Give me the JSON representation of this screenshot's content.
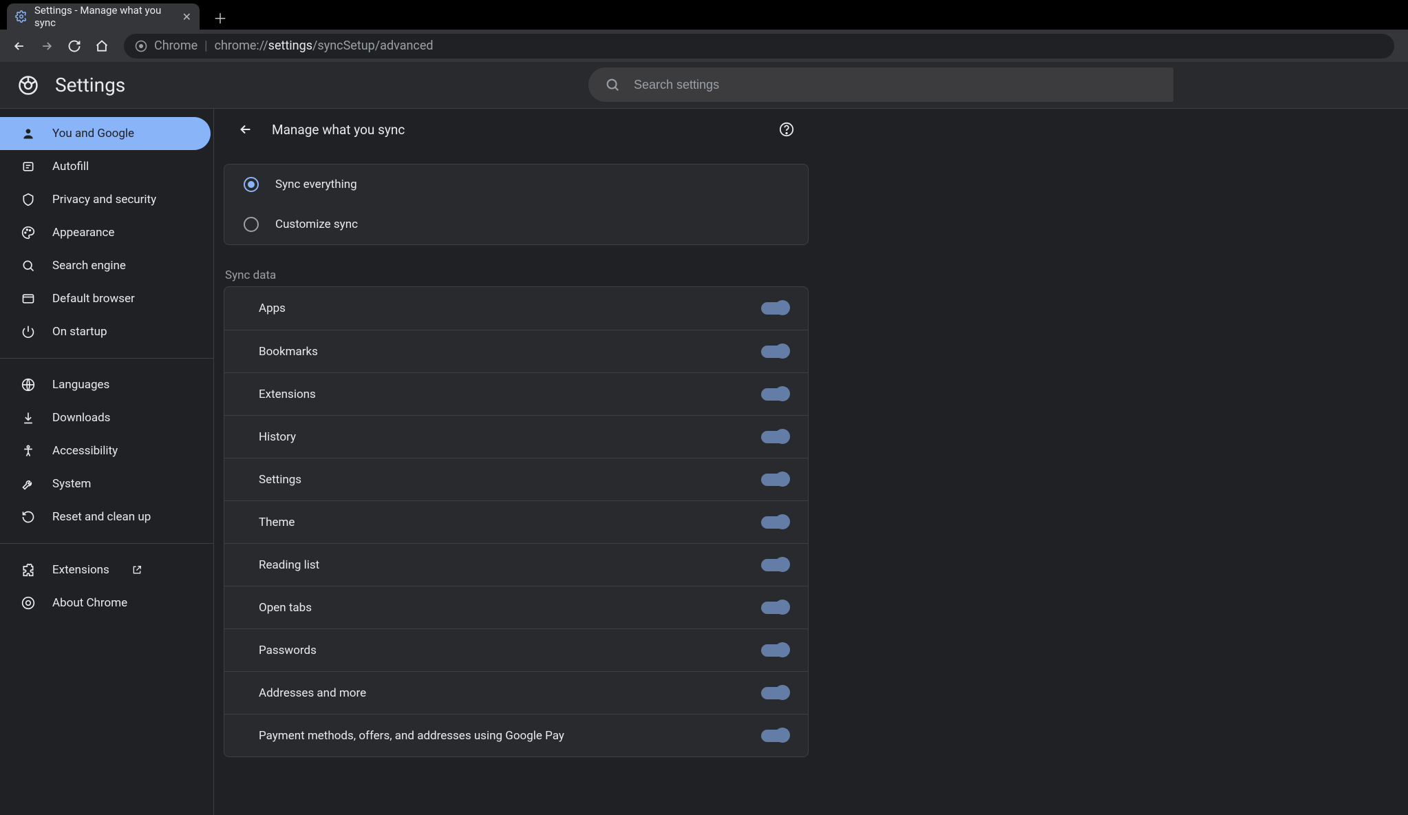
{
  "tab": {
    "title": "Settings - Manage what you sync"
  },
  "omnibox": {
    "prefix": "Chrome",
    "url_dim1": "chrome://",
    "url_bright": "settings",
    "url_dim2": "/syncSetup/advanced"
  },
  "header": {
    "app_title": "Settings",
    "search_placeholder": "Search settings"
  },
  "sidebar": {
    "group1": [
      {
        "label": "You and Google",
        "icon": "person"
      },
      {
        "label": "Autofill",
        "icon": "autofill"
      },
      {
        "label": "Privacy and security",
        "icon": "shield"
      },
      {
        "label": "Appearance",
        "icon": "palette"
      },
      {
        "label": "Search engine",
        "icon": "search"
      },
      {
        "label": "Default browser",
        "icon": "browser"
      },
      {
        "label": "On startup",
        "icon": "power"
      }
    ],
    "group2": [
      {
        "label": "Languages",
        "icon": "globe"
      },
      {
        "label": "Downloads",
        "icon": "download"
      },
      {
        "label": "Accessibility",
        "icon": "accessibility"
      },
      {
        "label": "System",
        "icon": "wrench"
      },
      {
        "label": "Reset and clean up",
        "icon": "restore"
      }
    ],
    "group3": [
      {
        "label": "Extensions",
        "icon": "puzzle",
        "external": true
      },
      {
        "label": "About Chrome",
        "icon": "chrome"
      }
    ]
  },
  "page": {
    "title": "Manage what you sync",
    "radio": {
      "sync_everything": "Sync everything",
      "customize_sync": "Customize sync",
      "selected": "sync_everything"
    },
    "section_label": "Sync data",
    "toggles": [
      {
        "label": "Apps",
        "on": true
      },
      {
        "label": "Bookmarks",
        "on": true
      },
      {
        "label": "Extensions",
        "on": true
      },
      {
        "label": "History",
        "on": true
      },
      {
        "label": "Settings",
        "on": true
      },
      {
        "label": "Theme",
        "on": true
      },
      {
        "label": "Reading list",
        "on": true
      },
      {
        "label": "Open tabs",
        "on": true
      },
      {
        "label": "Passwords",
        "on": true
      },
      {
        "label": "Addresses and more",
        "on": true
      },
      {
        "label": "Payment methods, offers, and addresses using Google Pay",
        "on": true
      }
    ]
  }
}
